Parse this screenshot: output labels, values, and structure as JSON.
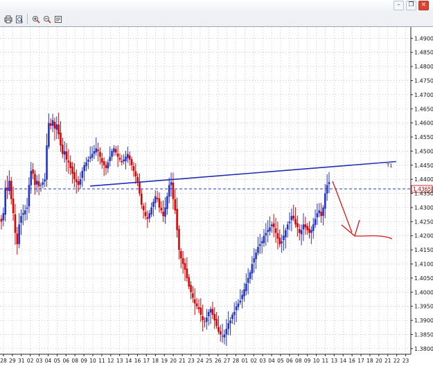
{
  "window": {
    "controls": [
      {
        "name": "minimize",
        "glyph": "–"
      },
      {
        "name": "restore",
        "glyph": "❐"
      },
      {
        "name": "close",
        "glyph": "×"
      }
    ]
  },
  "toolbar": {
    "buttons": [
      {
        "name": "print-icon"
      },
      {
        "name": "print-preview-icon"
      },
      {
        "name": "zoom-in-icon"
      },
      {
        "name": "zoom-out-icon"
      },
      {
        "name": "properties-icon"
      }
    ]
  },
  "chart_data": {
    "type": "candlestick",
    "colors": {
      "up": "#2233cc",
      "down": "#e00000",
      "trendline": "#1f2bb5",
      "hline": "#2233cc",
      "arrow": "#e01010",
      "price_tag": "#c00000",
      "grid": "#9aa3b5"
    },
    "y_axis": {
      "min": 1.378,
      "max": 1.494,
      "grid": "dotted",
      "ticks": [
        "1.49000",
        "1.48500",
        "1.48000",
        "1.47500",
        "1.47000",
        "1.46500",
        "1.46000",
        "1.45500",
        "1.45000",
        "1.44500",
        "1.44000",
        "1.43500",
        "1.43000",
        "1.42500",
        "1.42000",
        "1.41500",
        "1.41000",
        "1.40500",
        "1.40000",
        "1.39500",
        "1.39000",
        "1.38500",
        "1.38000"
      ]
    },
    "x_axis": {
      "ticks": [
        "28",
        "29",
        "31",
        "02",
        "03",
        "04",
        "05",
        "06",
        "08",
        "09",
        "10",
        "11",
        "12",
        "13",
        "14",
        "16",
        "17",
        "18",
        "19",
        "20",
        "21",
        "23",
        "24",
        "25",
        "26",
        "27",
        "28",
        "01",
        "02",
        "03",
        "04",
        "05",
        "06",
        "08",
        "09",
        "10",
        "11",
        "13",
        "14",
        "16",
        "17",
        "18",
        "20",
        "21",
        "22",
        "23"
      ]
    },
    "current_price": "1.43658",
    "horizontal_line": 1.4366,
    "trendline": {
      "from": {
        "bar": 45,
        "price": 1.4376
      },
      "to": {
        "bar": 200,
        "price": 1.4463
      }
    },
    "trendline_label": "T1",
    "closes": [
      1.425,
      1.428,
      1.437,
      1.436,
      1.4395,
      1.433,
      1.428,
      1.421,
      1.417,
      1.424,
      1.427,
      1.428,
      1.429,
      1.43,
      1.438,
      1.443,
      1.442,
      1.438,
      1.4395,
      1.4375,
      1.438,
      1.439,
      1.44,
      1.452,
      1.46,
      1.459,
      1.461,
      1.458,
      1.4595,
      1.456,
      1.452,
      1.449,
      1.45,
      1.447,
      1.446,
      1.444,
      1.442,
      1.44,
      1.439,
      1.438,
      1.44,
      1.443,
      1.445,
      1.446,
      1.447,
      1.448,
      1.449,
      1.45,
      1.451,
      1.45,
      1.448,
      1.446,
      1.445,
      1.444,
      1.446,
      1.448,
      1.45,
      1.451,
      1.4495,
      1.448,
      1.447,
      1.446,
      1.447,
      1.448,
      1.449,
      1.447,
      1.445,
      1.443,
      1.441,
      1.439,
      1.435,
      1.431,
      1.429,
      1.427,
      1.426,
      1.428,
      1.43,
      1.432,
      1.434,
      1.433,
      1.43,
      1.429,
      1.427,
      1.43,
      1.434,
      1.438,
      1.439,
      1.433,
      1.429,
      1.422,
      1.415,
      1.412,
      1.41,
      1.408,
      1.405,
      1.402,
      1.4,
      1.398,
      1.396,
      1.395,
      1.394,
      1.392,
      1.39,
      1.3895,
      1.391,
      1.393,
      1.394,
      1.392,
      1.39,
      1.388,
      1.386,
      1.385,
      1.3845,
      1.385,
      1.387,
      1.389,
      1.39,
      1.392,
      1.393,
      1.395,
      1.396,
      1.397,
      1.399,
      1.401,
      1.403,
      1.405,
      1.407,
      1.41,
      1.412,
      1.414,
      1.416,
      1.417,
      1.418,
      1.42,
      1.421,
      1.422,
      1.423,
      1.424,
      1.423,
      1.421,
      1.419,
      1.417,
      1.418,
      1.42,
      1.422,
      1.424,
      1.425,
      1.427,
      1.426,
      1.424,
      1.423,
      1.421,
      1.422,
      1.424,
      1.423,
      1.422,
      1.421,
      1.422,
      1.424,
      1.426,
      1.428,
      1.429,
      1.427,
      1.43,
      1.435,
      1.438,
      1.439
    ]
  }
}
